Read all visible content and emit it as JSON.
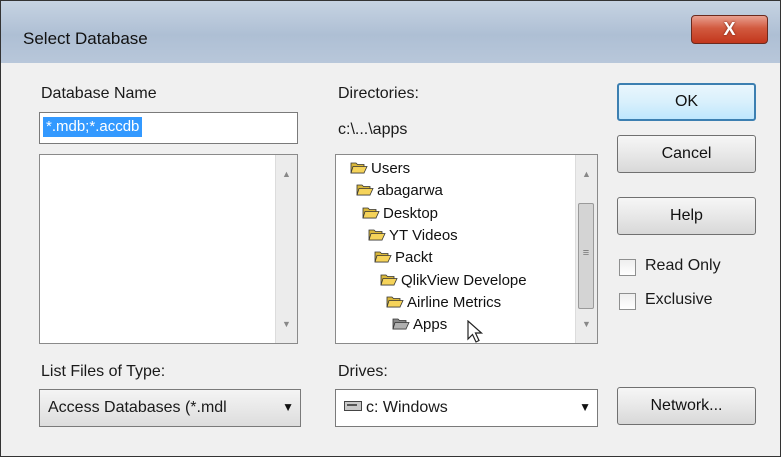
{
  "window": {
    "title": "Select Database",
    "close_glyph": "X"
  },
  "database_name": {
    "label": "Database Name",
    "value": "*.mdb;*.accdb"
  },
  "directories": {
    "label": "Directories:",
    "current_path": "c:\\...\\apps",
    "tree": [
      {
        "name": "Users",
        "icon": "open-folder-icon"
      },
      {
        "name": "abagarwa",
        "icon": "open-folder-icon"
      },
      {
        "name": "Desktop",
        "icon": "open-folder-icon"
      },
      {
        "name": "YT Videos",
        "icon": "open-folder-icon"
      },
      {
        "name": "Packt",
        "icon": "open-folder-icon"
      },
      {
        "name": "QlikView Develope",
        "icon": "open-folder-icon"
      },
      {
        "name": "Airline Metrics",
        "icon": "open-folder-icon"
      },
      {
        "name": "Apps",
        "icon": "open-folder-icon",
        "selected": true
      }
    ]
  },
  "buttons": {
    "ok": "OK",
    "cancel": "Cancel",
    "help": "Help",
    "network": "Network..."
  },
  "checkboxes": {
    "read_only": {
      "label": "Read Only",
      "checked": false
    },
    "exclusive": {
      "label": "Exclusive",
      "checked": false
    }
  },
  "file_type": {
    "label": "List Files of Type:",
    "selected": "Access Databases (*.mdl"
  },
  "drives": {
    "label": "Drives:",
    "selected": "c: Windows",
    "icon": "drive-icon"
  },
  "colors": {
    "selection": "#3399ff",
    "folder": "#f5d35a",
    "close_button": "#c8442a",
    "default_button_border": "#3c7fb1"
  }
}
